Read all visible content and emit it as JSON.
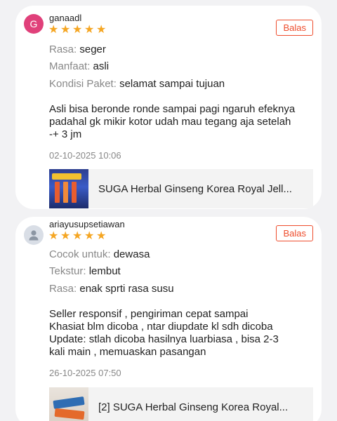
{
  "reviews": [
    {
      "avatar_letter": "G",
      "username": "ganaadl",
      "stars": 5,
      "reply_label": "Balas",
      "attributes": [
        {
          "key": "Rasa:",
          "value": "seger"
        },
        {
          "key": "Manfaat:",
          "value": "asli"
        },
        {
          "key": "Kondisi Paket:",
          "value": "selamat sampai tujuan"
        }
      ],
      "text_lines": [
        "Asli bisa beronde ronde sampai pagi ngaruh efeknya",
        "padahal gk mikir kotor udah mau tegang aja setelah",
        "-+ 3 jm"
      ],
      "date": "02-10-2025 10:06",
      "product_name": "SUGA Herbal Ginseng Korea Royal Jell..."
    },
    {
      "avatar_icon": "user-icon",
      "username": "ariayusupsetiawan",
      "stars": 5,
      "reply_label": "Balas",
      "attributes": [
        {
          "key": "Cocok untuk:",
          "value": "dewasa"
        },
        {
          "key": "Tekstur:",
          "value": "lembut"
        },
        {
          "key": "Rasa:",
          "value": "enak sprti rasa susu"
        }
      ],
      "text_lines": [
        "Seller responsif , pengiriman cepat sampai",
        "Khasiat blm dicoba , ntar diupdate kl sdh dicoba",
        "Update: stlah dicoba hasilnya luarbiasa , bisa 2-3",
        "kali main , memuaskan pasangan"
      ],
      "date": "26-10-2025 07:50",
      "product_name": "[2] SUGA Herbal Ginseng Korea Royal..."
    }
  ],
  "colors": {
    "accent": "#ee4d2d",
    "star": "#f5a623",
    "avatar_g": "#e0407a",
    "muted": "#888888"
  }
}
